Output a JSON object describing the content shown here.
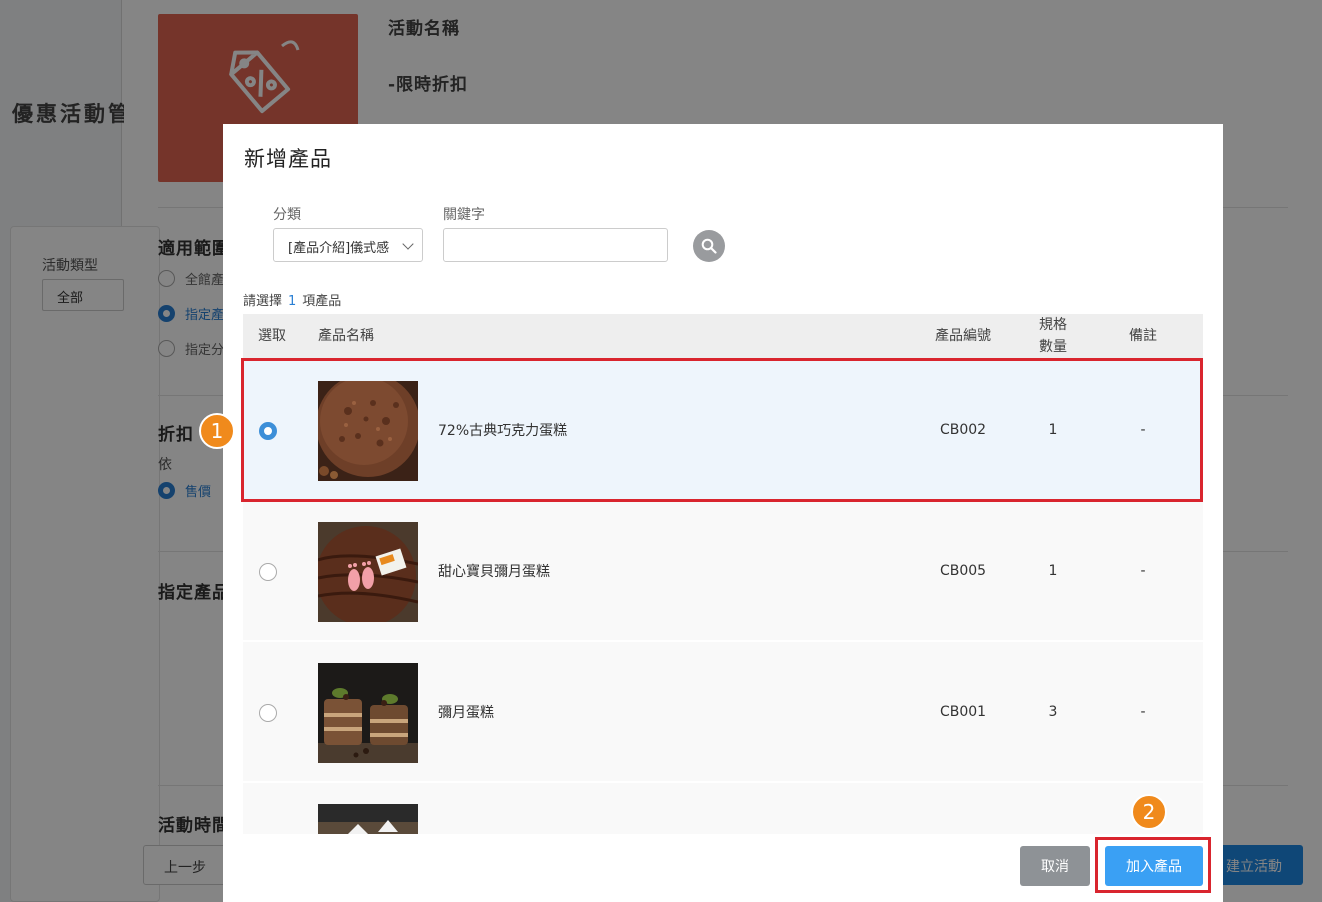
{
  "background": {
    "page_title": "優惠活動管理",
    "filter": {
      "label": "活動類型",
      "value": "全部"
    },
    "activity_name_label": "活動名稱",
    "activity_name_value": "-限時折扣",
    "sections": {
      "scope_title": "適用範圍",
      "scope_options": [
        "全館產品",
        "指定產品",
        "指定分類"
      ],
      "discount_title": "折扣",
      "discount_by": "依",
      "discount_option": "售價",
      "assigned_title": "指定產品",
      "time_title": "活動時間"
    },
    "prev_button": "上一步",
    "create_button": "建立活動"
  },
  "modal": {
    "title": "新增產品",
    "category_label": "分類",
    "category_value": "[產品介紹]儀式感",
    "keyword_label": "關鍵字",
    "keyword_value": "",
    "hint_prefix": "請選擇",
    "hint_count": "1",
    "hint_suffix": "項產品",
    "columns": {
      "select": "選取",
      "name": "產品名稱",
      "code": "產品編號",
      "spec_line1": "規格",
      "spec_line2": "數量",
      "note": "備註"
    },
    "rows": [
      {
        "name": "72%古典巧克力蛋糕",
        "code": "CB002",
        "qty": "1",
        "note": "-",
        "selected": true
      },
      {
        "name": "甜心寶貝彌月蛋糕",
        "code": "CB005",
        "qty": "1",
        "note": "-",
        "selected": false
      },
      {
        "name": "彌月蛋糕",
        "code": "CB001",
        "qty": "3",
        "note": "-",
        "selected": false
      }
    ],
    "cancel_button": "取消",
    "add_button": "加入產品"
  },
  "callouts": {
    "step1": "1",
    "step2": "2"
  },
  "colors": {
    "accent": "#3aa0f4",
    "callout": "#d9252e",
    "badge": "#f08a1c",
    "hero": "#e06552"
  }
}
